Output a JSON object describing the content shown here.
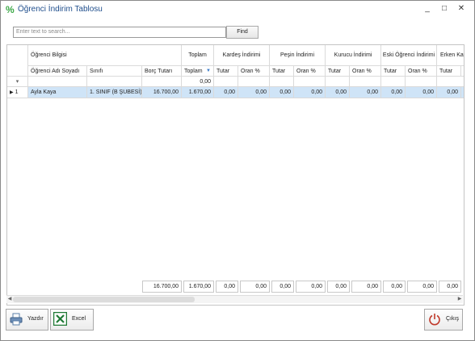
{
  "window": {
    "title": "Öğrenci İndirim Tablosu",
    "icon": "percent-icon",
    "minimize": "_",
    "maximize": "□",
    "close": "✕"
  },
  "search": {
    "placeholder": "Enter text to search...",
    "find_label": "Find"
  },
  "grid": {
    "bands": {
      "ogrenci_bilgisi": "Öğrenci Bilgisi",
      "toplam": "Toplam",
      "kardes": "Kardeş İndirimi",
      "pesin": "Peşin İndirimi",
      "kurucu": "Kurucu İndirimi",
      "eski": "Eski Öğrenci İndirimi",
      "erken": "Erken Kay"
    },
    "columns": {
      "ad_soyad": "Öğrenci Adı Soyadı",
      "sinif": "Sınıfı",
      "borc": "Borç Tutarı",
      "toplam": "Toplam",
      "kardes_tutar": "Tutar",
      "kardes_oran": "Oran %",
      "pesin_tutar": "Tutar",
      "pesin_oran": "Oran %",
      "kurucu_tutar": "Tutar",
      "kurucu_oran": "Oran %",
      "eski_tutar": "Tutar",
      "eski_oran": "Oran %",
      "erken_tutar": "Tutar",
      "erken_clip": "("
    },
    "filter_row": {
      "toplam": "0,00"
    },
    "rows": [
      {
        "no": "1",
        "ad_soyad": "Ayla Kaya",
        "sinif": "1. SINIF (B ŞUBESİ)",
        "borc": "16.700,00",
        "toplam": "1.670,00",
        "kardes_tutar": "0,00",
        "kardes_oran": "0,00",
        "pesin_tutar": "0,00",
        "pesin_oran": "0,00",
        "kurucu_tutar": "0,00",
        "kurucu_oran": "0,00",
        "eski_tutar": "0,00",
        "eski_oran": "0,00",
        "erken_tutar": "0,00"
      }
    ],
    "footer": {
      "borc": "16.700,00",
      "toplam": "1.670,00",
      "kardes_tutar": "0,00",
      "kardes_oran": "0,00",
      "pesin_tutar": "0,00",
      "pesin_oran": "0,00",
      "kurucu_tutar": "0,00",
      "kurucu_oran": "0,00",
      "eski_tutar": "0,00",
      "eski_oran": "0,00",
      "erken_tutar": "0,00"
    }
  },
  "buttons": {
    "yazdir": "Yazdır",
    "excel": "Excel",
    "cikis": "Çıkış"
  },
  "colors": {
    "selected_row": "#cfe4f7",
    "title_text": "#1f4e8c",
    "excel_green": "#1f7a35",
    "exit_red": "#c0392b"
  }
}
